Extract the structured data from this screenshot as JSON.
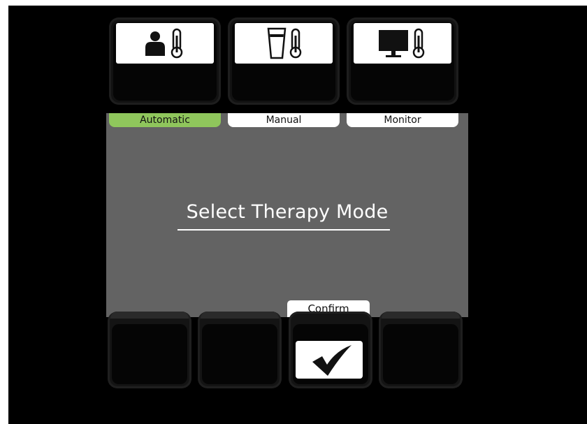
{
  "modes": [
    {
      "label": "Automatic",
      "icon": "patient-thermometer-icon",
      "selected": true
    },
    {
      "label": "Manual",
      "icon": "cup-thermometer-icon",
      "selected": false
    },
    {
      "label": "Monitor",
      "icon": "monitor-thermometer-icon",
      "selected": false
    }
  ],
  "main": {
    "title": "Select Therapy Mode"
  },
  "softkeys": {
    "confirm_label": "Confirm",
    "confirm_icon": "checkmark-icon"
  },
  "colors": {
    "selected_accent": "#8fc65c",
    "panel": "#636363",
    "background": "#000000"
  }
}
